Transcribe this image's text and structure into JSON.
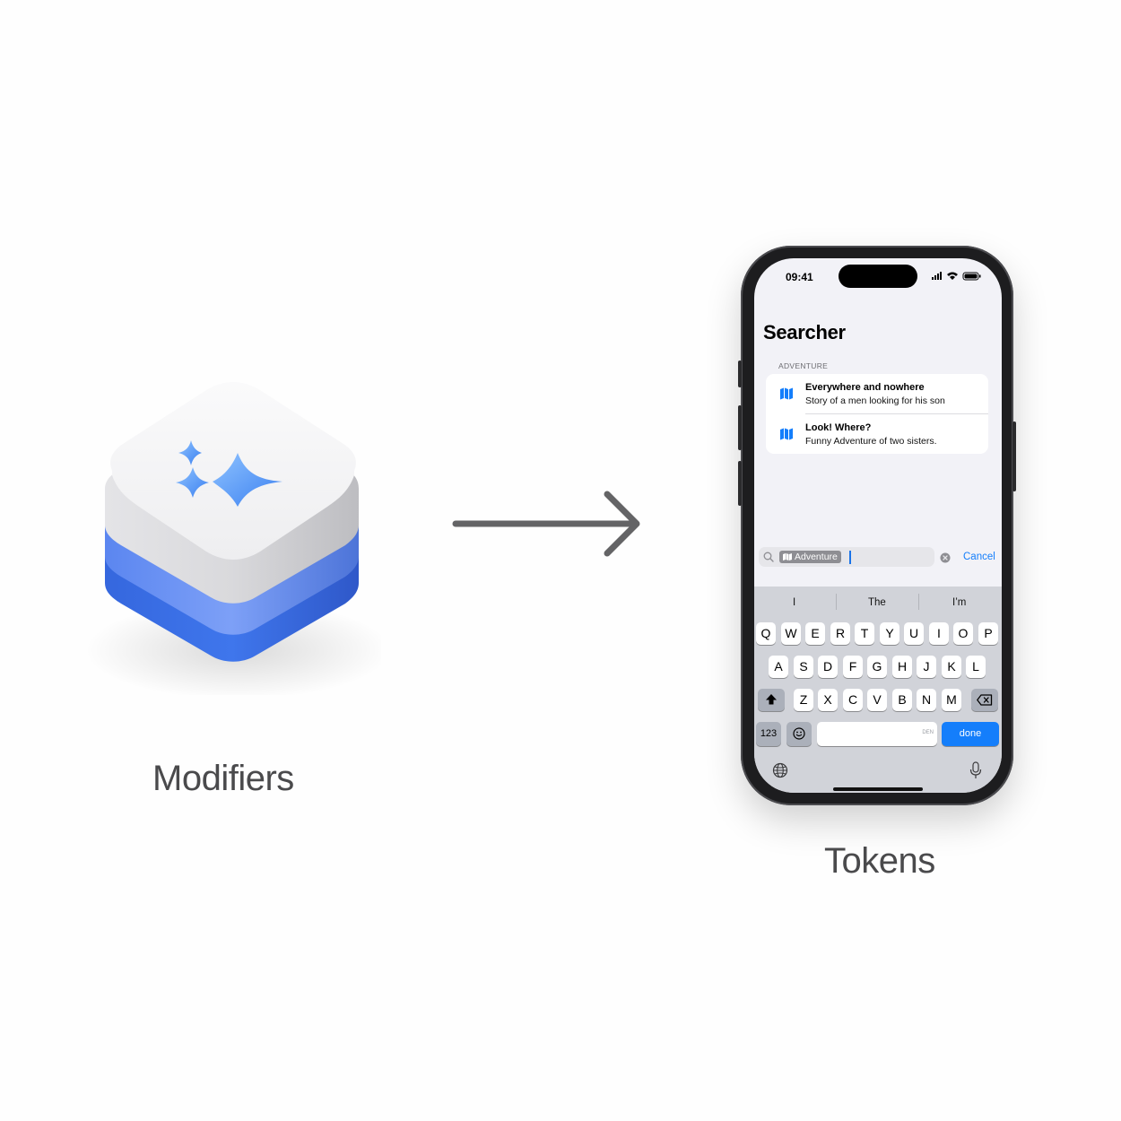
{
  "left": {
    "caption": "Modifiers"
  },
  "right": {
    "caption": "Tokens"
  },
  "colors": {
    "accent": "#147efb",
    "token_bg": "#8e8e93",
    "icon_blue": "#3a6fe0"
  },
  "phone": {
    "status": {
      "time": "09:41"
    },
    "title": "Searcher",
    "section_header": "ADVENTURE",
    "rows": [
      {
        "icon": "map-icon",
        "title": "Everywhere and nowhere",
        "subtitle": "Story of a men looking for his son"
      },
      {
        "icon": "map-icon",
        "title": "Look! Where?",
        "subtitle": "Funny Adventure of two sisters."
      }
    ],
    "search": {
      "token": "Adventure",
      "cancel": "Cancel"
    },
    "keyboard": {
      "suggestions": [
        "I",
        "The",
        "I’m"
      ],
      "row1": [
        "Q",
        "W",
        "E",
        "R",
        "T",
        "Y",
        "U",
        "I",
        "O",
        "P"
      ],
      "row2": [
        "A",
        "S",
        "D",
        "F",
        "G",
        "H",
        "J",
        "K",
        "L"
      ],
      "row3": [
        "Z",
        "X",
        "C",
        "V",
        "B",
        "N",
        "M"
      ],
      "numbers_key": "123",
      "space_hint": "DEN",
      "done_key": "done"
    }
  }
}
